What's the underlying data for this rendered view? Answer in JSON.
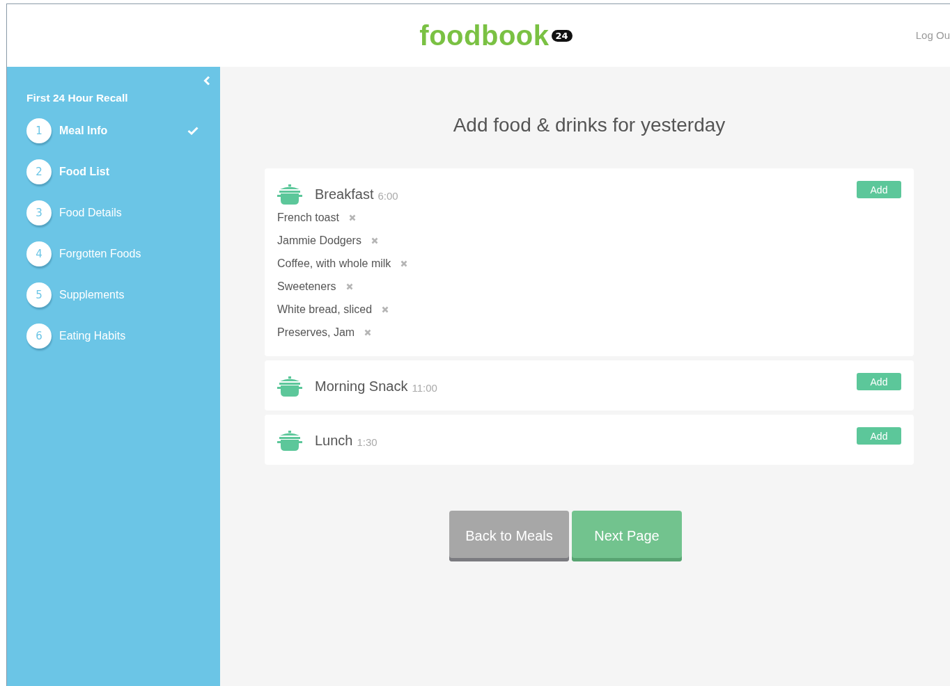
{
  "header": {
    "logo": "foodbook",
    "logo_badge": "24",
    "logout": "Log Ou"
  },
  "sidebar": {
    "title": "First 24 Hour Recall",
    "steps": [
      {
        "number": "1",
        "label": "Meal Info",
        "reached": true,
        "done": true
      },
      {
        "number": "2",
        "label": "Food List",
        "reached": true,
        "done": false
      },
      {
        "number": "3",
        "label": "Food Details",
        "reached": false,
        "done": false
      },
      {
        "number": "4",
        "label": "Forgotten Foods",
        "reached": false,
        "done": false
      },
      {
        "number": "5",
        "label": "Supplements",
        "reached": false,
        "done": false
      },
      {
        "number": "6",
        "label": "Eating Habits",
        "reached": false,
        "done": false
      }
    ]
  },
  "main": {
    "heading": "Add food & drinks for yesterday",
    "meals": [
      {
        "name": "Breakfast",
        "time": "6:00",
        "add": "Add",
        "foods": [
          "French toast",
          "Jammie Dodgers",
          "Coffee, with whole milk",
          "Sweeteners",
          "White bread, sliced",
          "Preserves, Jam"
        ]
      },
      {
        "name": "Morning Snack",
        "time": "11:00",
        "add": "Add"
      },
      {
        "name": "Lunch",
        "time": "1:30",
        "add": "Add"
      }
    ],
    "buttons": [
      {
        "label": "Back to Meals",
        "kind": "secondary"
      },
      {
        "label": "Next Page",
        "kind": "primary"
      }
    ]
  }
}
